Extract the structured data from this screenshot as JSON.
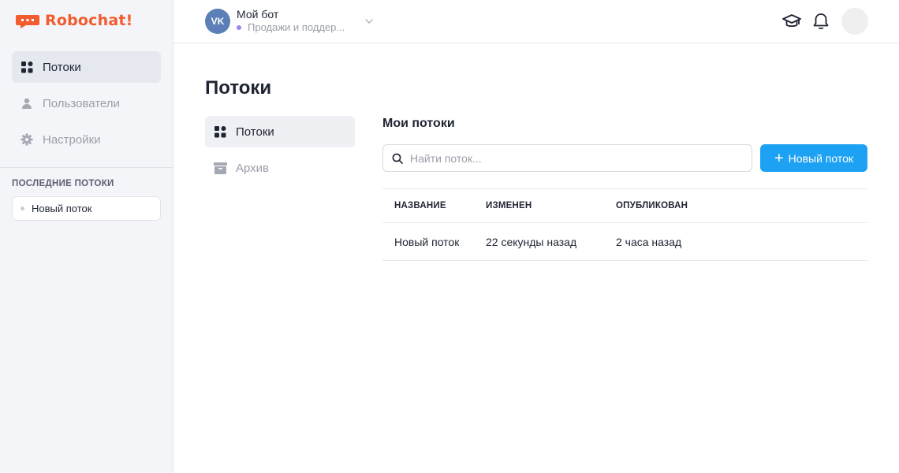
{
  "brand": {
    "name": "Robochat!",
    "color": "#f25c2e"
  },
  "sidebar": {
    "items": [
      {
        "label": "Потоки",
        "icon": "grid-icon",
        "active": true
      },
      {
        "label": "Пользователи",
        "icon": "user-icon",
        "active": false
      },
      {
        "label": "Настройки",
        "icon": "gear-icon",
        "active": false
      }
    ],
    "recent_title": "ПОСЛЕДНИЕ ПОТОКИ",
    "recent": [
      {
        "label": "Новый поток"
      }
    ]
  },
  "topbar": {
    "bot_avatar_text": "VK",
    "bot_name": "Мой бот",
    "bot_subtitle": "Продажи и поддер...",
    "icons": [
      "graduation-cap-icon",
      "bell-icon"
    ]
  },
  "page": {
    "title": "Потоки",
    "subnav": [
      {
        "label": "Потоки",
        "icon": "grid-icon",
        "active": true
      },
      {
        "label": "Архив",
        "icon": "archive-icon",
        "active": false
      }
    ],
    "section_title": "Мои потоки",
    "search_placeholder": "Найти поток...",
    "new_button_label": "Новый поток",
    "table": {
      "columns": [
        "НАЗВАНИЕ",
        "ИЗМЕНЕН",
        "ОПУБЛИКОВАН"
      ],
      "rows": [
        {
          "name": "Новый поток",
          "modified": "22 секунды назад",
          "published": "2 часа назад"
        }
      ]
    }
  },
  "colors": {
    "accent": "#1da1f2",
    "sidebar_bg": "#f4f5f8",
    "status_dot": "#9b86f0"
  }
}
